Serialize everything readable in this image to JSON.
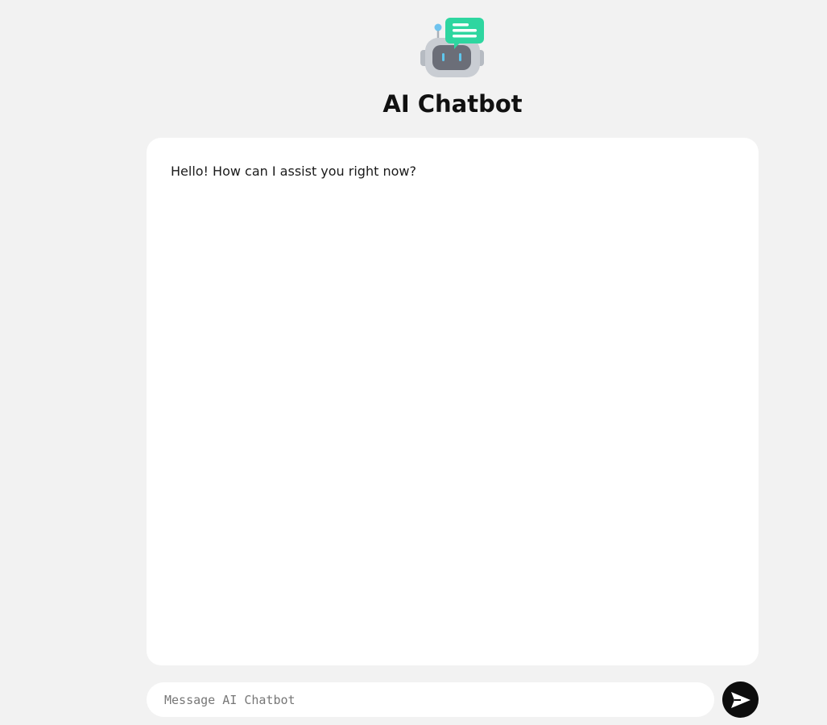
{
  "header": {
    "title": "AI Chatbot",
    "logo_icon": "robot-chat-icon"
  },
  "chat": {
    "messages": [
      {
        "role": "bot",
        "text": "Hello! How can I assist you right now?"
      }
    ]
  },
  "composer": {
    "placeholder": "Message AI Chatbot",
    "value": "",
    "send_icon": "send-arrow-icon"
  },
  "colors": {
    "background": "#f2f2f2",
    "panel": "#ffffff",
    "accent_green": "#2ed6a0",
    "robot_gray": "#c9cdd3",
    "robot_face": "#6b6e78",
    "robot_eyes": "#5fc7ee",
    "send_button": "#0d0d0d"
  }
}
